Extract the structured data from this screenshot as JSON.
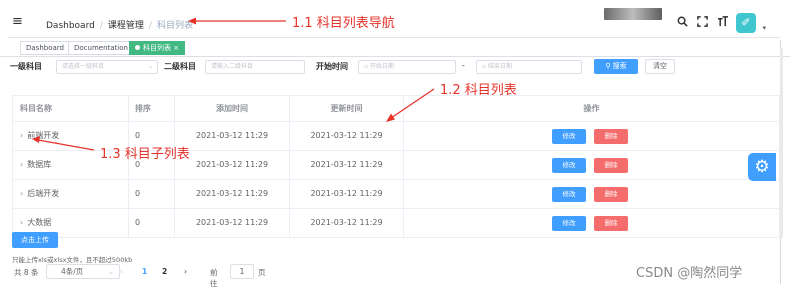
{
  "navbar": {
    "breadcrumb": [
      "Dashboard",
      "课程管理",
      "科目列表"
    ],
    "icons": [
      "search-icon",
      "fullscreen-icon",
      "font-size-icon"
    ]
  },
  "tags": {
    "items": [
      "Dashboard",
      "Documentation",
      "科目列表"
    ],
    "close": "×"
  },
  "search": {
    "label_level1": "一级科目",
    "placeholder_level1": "请选择一级科目",
    "label_level2": "二级科目",
    "placeholder_level2": "请输入二级科目",
    "label_start": "开始时间",
    "placeholder_start": "开始日期",
    "range_sep": "-",
    "placeholder_end": "结束日期",
    "search_button": "搜索",
    "reset_button": "清空"
  },
  "table": {
    "headers": [
      "科目名称",
      "排序",
      "添加时间",
      "更新时间",
      "操作"
    ],
    "rows": [
      {
        "name": "前端开发",
        "sort": "0",
        "created": "2021-03-12 11:29",
        "updated": "2021-03-12 11:29"
      },
      {
        "name": "数据库",
        "sort": "0",
        "created": "2021-03-12 11:29",
        "updated": "2021-03-12 11:29"
      },
      {
        "name": "后端开发",
        "sort": "0",
        "created": "2021-03-12 11:29",
        "updated": "2021-03-12 11:29"
      },
      {
        "name": "大数据",
        "sort": "0",
        "created": "2021-03-12 11:29",
        "updated": "2021-03-12 11:29"
      }
    ],
    "edit_label": "修改",
    "delete_label": "删除"
  },
  "upload": {
    "button": "点击上传",
    "tip": "只能上传xls或xlsx文件，且不超过500kb"
  },
  "pagination": {
    "total": "共 8 条",
    "page_size": "4条/页",
    "prev": "‹",
    "pages": [
      "1",
      "2"
    ],
    "next": "›",
    "goto_label": "前往",
    "goto_value": "1",
    "unit": "页"
  },
  "annotations": {
    "a1": "1.1 科目列表导航",
    "a2": "1.2 科目列表",
    "a3": "1.3 科目子列表"
  },
  "watermark": "CSDN @陶然同学",
  "colors": {
    "primary": "#409eff",
    "danger": "#f56c6c",
    "active_tag": "#42b983",
    "annotation": "#e5332a"
  }
}
